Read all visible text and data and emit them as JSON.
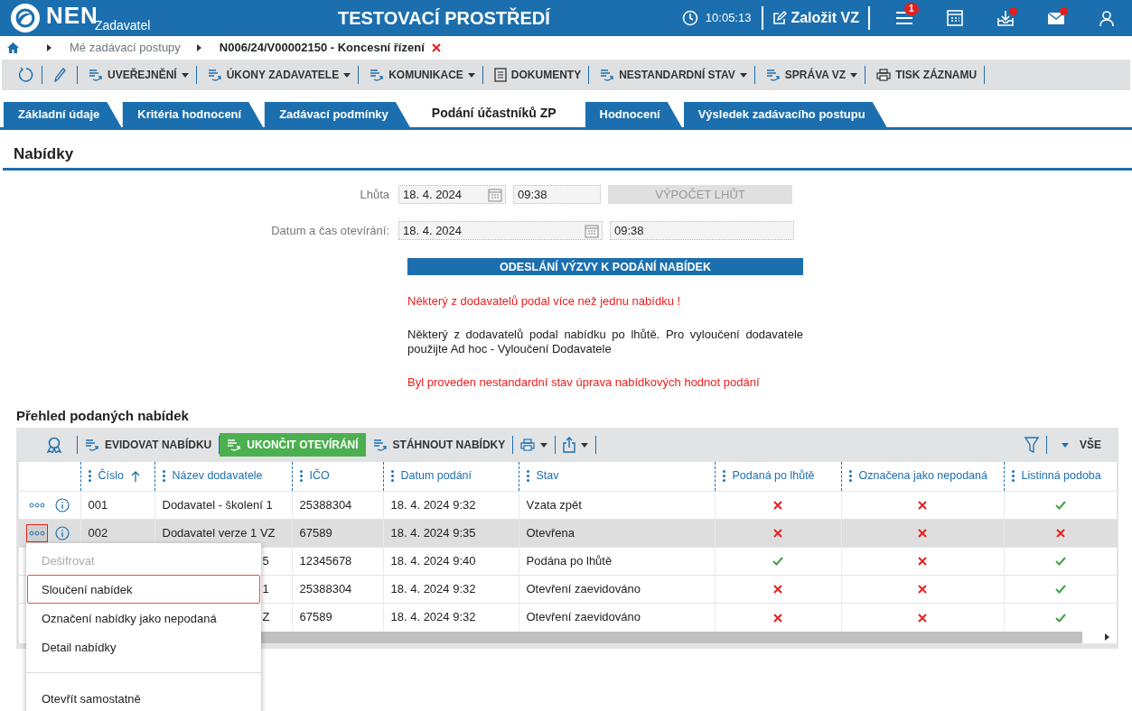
{
  "header": {
    "logo": "NEN",
    "logo_sub": "Zadavatel",
    "environment": "TESTOVACÍ PROSTŘEDÍ",
    "time": "10:05:13",
    "create_label": "Založit VZ",
    "menu_badge": "1",
    "downloads_dot": true,
    "mail_dot": true
  },
  "breadcrumb": [
    "Mé zadávací postupy",
    "N006/24/V00002150 - Koncesní řízení"
  ],
  "toolbar": [
    {
      "kind": "flow",
      "label": "UVEŘEJNĚNÍ",
      "dropdown": true
    },
    {
      "kind": "flow",
      "label": "ÚKONY ZADAVATELE",
      "dropdown": true
    },
    {
      "kind": "flow",
      "label": "KOMUNIKACE",
      "dropdown": true
    },
    {
      "kind": "document",
      "label": "DOKUMENTY",
      "dropdown": false
    },
    {
      "kind": "flow",
      "label": "NESTANDARDNÍ STAV",
      "dropdown": true
    },
    {
      "kind": "flow",
      "label": "SPRÁVA VZ",
      "dropdown": true
    },
    {
      "kind": "print",
      "label": "TISK ZÁZNAMU",
      "dropdown": false
    }
  ],
  "tabs": [
    {
      "label": "Základní údaje",
      "selected": false
    },
    {
      "label": "Kritéria hodnocení",
      "selected": false
    },
    {
      "label": "Zadávací podmínky",
      "selected": false
    },
    {
      "label": "Podání účastníků ZP",
      "selected": true
    },
    {
      "label": "Hodnocení",
      "selected": false
    },
    {
      "label": "Výsledek zadávacího postupu",
      "selected": false
    }
  ],
  "section_title": "Nabídky",
  "form": {
    "deadline_label": "Lhůta",
    "deadline_date": "18. 4. 2024",
    "deadline_time": "09:38",
    "calc_button": "VÝPOČET LHŮT",
    "calc_disabled": true,
    "opening_label": "Datum a čas otevírání:",
    "opening_date": "18. 4. 2024",
    "opening_time": "09:38",
    "send_button": "ODESLÁNÍ VÝZVY K PODÁNÍ NABÍDEK"
  },
  "messages": [
    {
      "kind": "error",
      "text": "Některý z dodavatelů podal více než jednu nabídku !"
    },
    {
      "kind": "info",
      "text": "Některý z dodavatelů podal nabídku po lhůtě. Pro vyloučení dodavatele použijte Ad hoc - Vyloučení Dodavatele"
    },
    {
      "kind": "error",
      "text": "Byl proveden nestandardní stav úprava nabídkových hodnot podání"
    }
  ],
  "table_title": "Přehled podaných nabídek",
  "table_toolbar": [
    {
      "kind": "flow",
      "label": "EVIDOVAT NABÍDKU",
      "primary": false
    },
    {
      "kind": "flow",
      "label": "UKONČIT OTEVÍRÁNÍ",
      "primary": true
    },
    {
      "kind": "flow",
      "label": "STÁHNOUT NABÍDKY",
      "primary": false
    }
  ],
  "filter_label": "VŠE",
  "columns": [
    {
      "label": "Číslo",
      "sorted": true
    },
    {
      "label": "Název dodavatele",
      "sorted": false
    },
    {
      "label": "IČO",
      "sorted": false
    },
    {
      "label": "Datum podání",
      "sorted": false
    },
    {
      "label": "Stav",
      "sorted": false
    },
    {
      "label": "Podaná po lhůtě",
      "sorted": false
    },
    {
      "label": "Označena jako nepodaná",
      "sorted": false
    },
    {
      "label": "Listinná podoba",
      "sorted": false
    }
  ],
  "rows": [
    {
      "number": "001",
      "name": "Dodavatel - školení 1",
      "ico": "25388304",
      "date": "18. 4. 2024 9:32",
      "status": "Vzata zpět",
      "late": false,
      "unsubmitted": false,
      "paper": true,
      "selected": false,
      "actions_open": false
    },
    {
      "number": "002",
      "name": "Dodavatel verze 1 VZ",
      "ico": "67589",
      "date": "18. 4. 2024 9:35",
      "status": "Otevřena",
      "late": false,
      "unsubmitted": false,
      "paper": false,
      "selected": true,
      "actions_open": true
    },
    {
      "name": "5",
      "ico": "12345678",
      "date": "18. 4. 2024 9:40",
      "status": "Podána po lhůtě",
      "late": true,
      "unsubmitted": false,
      "paper": true,
      "selected": false
    },
    {
      "name": "1",
      "ico": "25388304",
      "date": "18. 4. 2024 9:32",
      "status": "Otevření zaevidováno",
      "late": false,
      "unsubmitted": false,
      "paper": true,
      "selected": false
    },
    {
      "name": "Z",
      "ico": "67589",
      "date": "18. 4. 2024 9:32",
      "status": "Otevření zaevidováno",
      "late": false,
      "unsubmitted": false,
      "paper": true,
      "selected": false
    }
  ],
  "menu": [
    {
      "kind": "item",
      "label": "Dešifrovat",
      "disabled": true,
      "highlighted": false
    },
    {
      "kind": "item",
      "label": "Sloučení nabídek",
      "disabled": false,
      "highlighted": true
    },
    {
      "kind": "item",
      "label": "Označení nabídky jako nepodaná",
      "disabled": false,
      "highlighted": false
    },
    {
      "kind": "item",
      "label": "Detail nabídky",
      "disabled": false,
      "highlighted": false
    },
    {
      "kind": "separator"
    },
    {
      "kind": "item",
      "label": "Otevřít samostatně",
      "disabled": false,
      "highlighted": false
    }
  ]
}
